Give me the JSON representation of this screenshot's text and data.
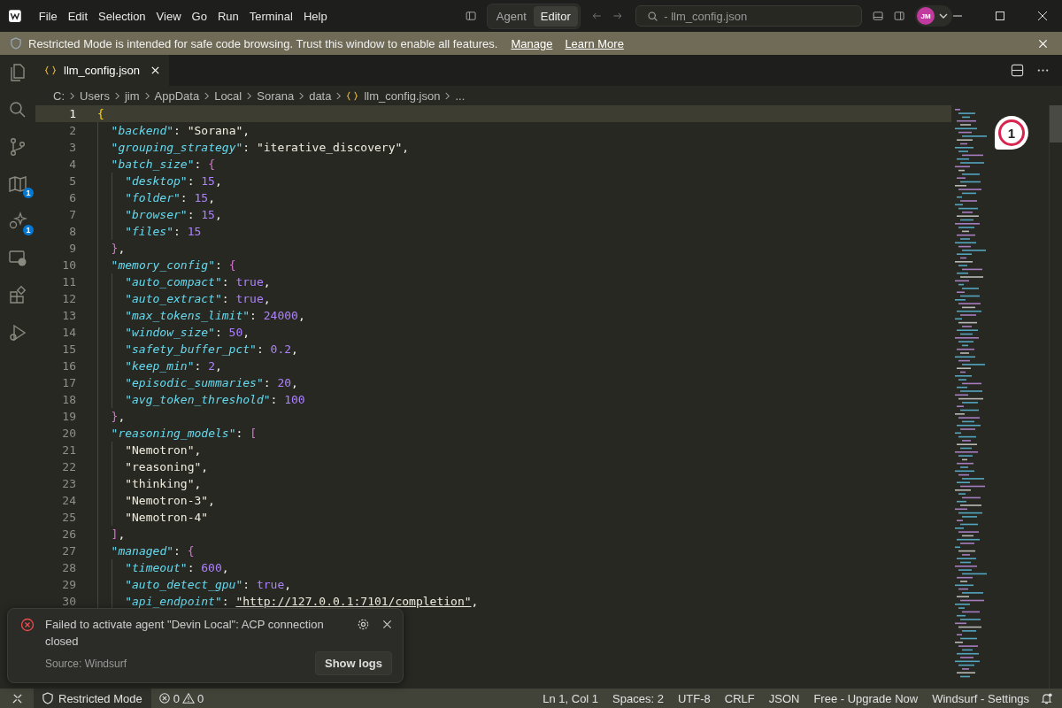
{
  "titlebar": {
    "menus": [
      "File",
      "Edit",
      "Selection",
      "View",
      "Go",
      "Run",
      "Terminal",
      "Help"
    ],
    "modes": [
      {
        "label": "Agent",
        "selected": false
      },
      {
        "label": "Editor",
        "selected": true
      }
    ],
    "search": {
      "value": "- llm_config.json"
    },
    "avatar": "JM"
  },
  "banner": {
    "text": "Restricted Mode is intended for safe code browsing. Trust this window to enable all features.",
    "links": [
      "Manage",
      "Learn More"
    ]
  },
  "activity_bar": [
    {
      "kind": "files"
    },
    {
      "kind": "search"
    },
    {
      "kind": "source-control"
    },
    {
      "kind": "map",
      "badge": "1"
    },
    {
      "kind": "sparkle",
      "badge": "1"
    },
    {
      "kind": "remote"
    },
    {
      "kind": "extensions"
    },
    {
      "kind": "run"
    }
  ],
  "tabs": [
    {
      "label": "llm_config.json",
      "selected": true
    }
  ],
  "breadcrumb": [
    {
      "label": "C:",
      "kind": "folder"
    },
    {
      "label": "Users",
      "kind": "folder"
    },
    {
      "label": "jim",
      "kind": "folder"
    },
    {
      "label": "AppData",
      "kind": "folder"
    },
    {
      "label": "Local",
      "kind": "folder"
    },
    {
      "label": "Sorana",
      "kind": "folder"
    },
    {
      "label": "data",
      "kind": "folder"
    },
    {
      "label": "llm_config.json",
      "kind": "json"
    },
    {
      "label": "...",
      "kind": "more"
    }
  ],
  "editor": {
    "annotation": "1",
    "lines": [
      {
        "n": "1",
        "current": true,
        "tokens": [
          {
            "kind": "b1",
            "text": "{"
          }
        ],
        "children": [
          {
            "n": "2",
            "current": false,
            "tokens": [
              {
                "kind": "key",
                "text": "\"backend\""
              },
              {
                "kind": "p",
                "text": ": "
              },
              {
                "kind": "str",
                "text": "\"Sorana\""
              },
              {
                "kind": "p",
                "text": ","
              }
            ]
          },
          {
            "n": "3",
            "current": false,
            "tokens": [
              {
                "kind": "key",
                "text": "\"grouping_strategy\""
              },
              {
                "kind": "p",
                "text": ": "
              },
              {
                "kind": "str",
                "text": "\"iterative_discovery\""
              },
              {
                "kind": "p",
                "text": ","
              }
            ]
          },
          {
            "n": "4",
            "current": false,
            "tokens": [
              {
                "kind": "key",
                "text": "\"batch_size\""
              },
              {
                "kind": "p",
                "text": ": "
              },
              {
                "kind": "b2",
                "text": "{"
              }
            ],
            "children": [
              {
                "n": "5",
                "current": false,
                "tokens": [
                  {
                    "kind": "key",
                    "text": "\"desktop\""
                  },
                  {
                    "kind": "p",
                    "text": ": "
                  },
                  {
                    "kind": "num",
                    "text": "15"
                  },
                  {
                    "kind": "p",
                    "text": ","
                  }
                ]
              },
              {
                "n": "6",
                "current": false,
                "tokens": [
                  {
                    "kind": "key",
                    "text": "\"folder\""
                  },
                  {
                    "kind": "p",
                    "text": ": "
                  },
                  {
                    "kind": "num",
                    "text": "15"
                  },
                  {
                    "kind": "p",
                    "text": ","
                  }
                ]
              },
              {
                "n": "7",
                "current": false,
                "tokens": [
                  {
                    "kind": "key",
                    "text": "\"browser\""
                  },
                  {
                    "kind": "p",
                    "text": ": "
                  },
                  {
                    "kind": "num",
                    "text": "15"
                  },
                  {
                    "kind": "p",
                    "text": ","
                  }
                ]
              },
              {
                "n": "8",
                "current": false,
                "tokens": [
                  {
                    "kind": "key",
                    "text": "\"files\""
                  },
                  {
                    "kind": "p",
                    "text": ": "
                  },
                  {
                    "kind": "num",
                    "text": "15"
                  }
                ]
              }
            ]
          },
          {
            "n": "9",
            "current": false,
            "tokens": [
              {
                "kind": "b2",
                "text": "}"
              },
              {
                "kind": "p",
                "text": ","
              }
            ]
          },
          {
            "n": "10",
            "current": false,
            "tokens": [
              {
                "kind": "key",
                "text": "\"memory_config\""
              },
              {
                "kind": "p",
                "text": ": "
              },
              {
                "kind": "b2",
                "text": "{"
              }
            ],
            "children": [
              {
                "n": "11",
                "current": false,
                "tokens": [
                  {
                    "kind": "key",
                    "text": "\"auto_compact\""
                  },
                  {
                    "kind": "p",
                    "text": ": "
                  },
                  {
                    "kind": "num",
                    "text": "true"
                  },
                  {
                    "kind": "p",
                    "text": ","
                  }
                ]
              },
              {
                "n": "12",
                "current": false,
                "tokens": [
                  {
                    "kind": "key",
                    "text": "\"auto_extract\""
                  },
                  {
                    "kind": "p",
                    "text": ": "
                  },
                  {
                    "kind": "num",
                    "text": "true"
                  },
                  {
                    "kind": "p",
                    "text": ","
                  }
                ]
              },
              {
                "n": "13",
                "current": false,
                "tokens": [
                  {
                    "kind": "key",
                    "text": "\"max_tokens_limit\""
                  },
                  {
                    "kind": "p",
                    "text": ": "
                  },
                  {
                    "kind": "num",
                    "text": "24000"
                  },
                  {
                    "kind": "p",
                    "text": ","
                  }
                ]
              },
              {
                "n": "14",
                "current": false,
                "tokens": [
                  {
                    "kind": "key",
                    "text": "\"window_size\""
                  },
                  {
                    "kind": "p",
                    "text": ": "
                  },
                  {
                    "kind": "num",
                    "text": "50"
                  },
                  {
                    "kind": "p",
                    "text": ","
                  }
                ]
              },
              {
                "n": "15",
                "current": false,
                "tokens": [
                  {
                    "kind": "key",
                    "text": "\"safety_buffer_pct\""
                  },
                  {
                    "kind": "p",
                    "text": ": "
                  },
                  {
                    "kind": "num",
                    "text": "0.2"
                  },
                  {
                    "kind": "p",
                    "text": ","
                  }
                ]
              },
              {
                "n": "16",
                "current": false,
                "tokens": [
                  {
                    "kind": "key",
                    "text": "\"keep_min\""
                  },
                  {
                    "kind": "p",
                    "text": ": "
                  },
                  {
                    "kind": "num",
                    "text": "2"
                  },
                  {
                    "kind": "p",
                    "text": ","
                  }
                ]
              },
              {
                "n": "17",
                "current": false,
                "tokens": [
                  {
                    "kind": "key",
                    "text": "\"episodic_summaries\""
                  },
                  {
                    "kind": "p",
                    "text": ": "
                  },
                  {
                    "kind": "num",
                    "text": "20"
                  },
                  {
                    "kind": "p",
                    "text": ","
                  }
                ]
              },
              {
                "n": "18",
                "current": false,
                "tokens": [
                  {
                    "kind": "key",
                    "text": "\"avg_token_threshold\""
                  },
                  {
                    "kind": "p",
                    "text": ": "
                  },
                  {
                    "kind": "num",
                    "text": "100"
                  }
                ]
              }
            ]
          },
          {
            "n": "19",
            "current": false,
            "tokens": [
              {
                "kind": "b2",
                "text": "}"
              },
              {
                "kind": "p",
                "text": ","
              }
            ]
          },
          {
            "n": "20",
            "current": false,
            "tokens": [
              {
                "kind": "key",
                "text": "\"reasoning_models\""
              },
              {
                "kind": "p",
                "text": ": "
              },
              {
                "kind": "b2",
                "text": "["
              }
            ],
            "children": [
              {
                "n": "21",
                "current": false,
                "tokens": [
                  {
                    "kind": "str",
                    "text": "\"Nemotron\""
                  },
                  {
                    "kind": "p",
                    "text": ","
                  }
                ]
              },
              {
                "n": "22",
                "current": false,
                "tokens": [
                  {
                    "kind": "str",
                    "text": "\"reasoning\""
                  },
                  {
                    "kind": "p",
                    "text": ","
                  }
                ]
              },
              {
                "n": "23",
                "current": false,
                "tokens": [
                  {
                    "kind": "str",
                    "text": "\"thinking\""
                  },
                  {
                    "kind": "p",
                    "text": ","
                  }
                ]
              },
              {
                "n": "24",
                "current": false,
                "tokens": [
                  {
                    "kind": "str",
                    "text": "\"Nemotron-3\""
                  },
                  {
                    "kind": "p",
                    "text": ","
                  }
                ]
              },
              {
                "n": "25",
                "current": false,
                "tokens": [
                  {
                    "kind": "str",
                    "text": "\"Nemotron-4\""
                  }
                ]
              }
            ]
          },
          {
            "n": "26",
            "current": false,
            "tokens": [
              {
                "kind": "b2",
                "text": "]"
              },
              {
                "kind": "p",
                "text": ","
              }
            ]
          },
          {
            "n": "27",
            "current": false,
            "tokens": [
              {
                "kind": "key",
                "text": "\"managed\""
              },
              {
                "kind": "p",
                "text": ": "
              },
              {
                "kind": "b2",
                "text": "{"
              }
            ],
            "children": [
              {
                "n": "28",
                "current": false,
                "tokens": [
                  {
                    "kind": "key",
                    "text": "\"timeout\""
                  },
                  {
                    "kind": "p",
                    "text": ": "
                  },
                  {
                    "kind": "num",
                    "text": "600"
                  },
                  {
                    "kind": "p",
                    "text": ","
                  }
                ]
              },
              {
                "n": "29",
                "current": false,
                "tokens": [
                  {
                    "kind": "key",
                    "text": "\"auto_detect_gpu\""
                  },
                  {
                    "kind": "p",
                    "text": ": "
                  },
                  {
                    "kind": "num",
                    "text": "true"
                  },
                  {
                    "kind": "p",
                    "text": ","
                  }
                ]
              },
              {
                "n": "30",
                "current": false,
                "tokens": [
                  {
                    "kind": "key",
                    "text": "\"api_endpoint\""
                  },
                  {
                    "kind": "p",
                    "text": ": "
                  },
                  {
                    "kind": "link",
                    "text": "\"http://127.0.0.1:7101/completion\""
                  },
                  {
                    "kind": "p",
                    "text": ","
                  }
                ]
              }
            ]
          }
        ]
      }
    ]
  },
  "notification": {
    "message": "Failed to activate agent \"Devin Local\": ACP connection closed",
    "source": "Source: Windsurf",
    "button": "Show logs"
  },
  "status_bar": {
    "restricted": "Restricted Mode",
    "errors": "0",
    "warnings": "0",
    "items": [
      "Ln 1, Col 1",
      "Spaces: 2",
      "UTF-8",
      "CRLF",
      "JSON",
      "Free - Upgrade Now",
      "Windsurf - Settings"
    ]
  }
}
